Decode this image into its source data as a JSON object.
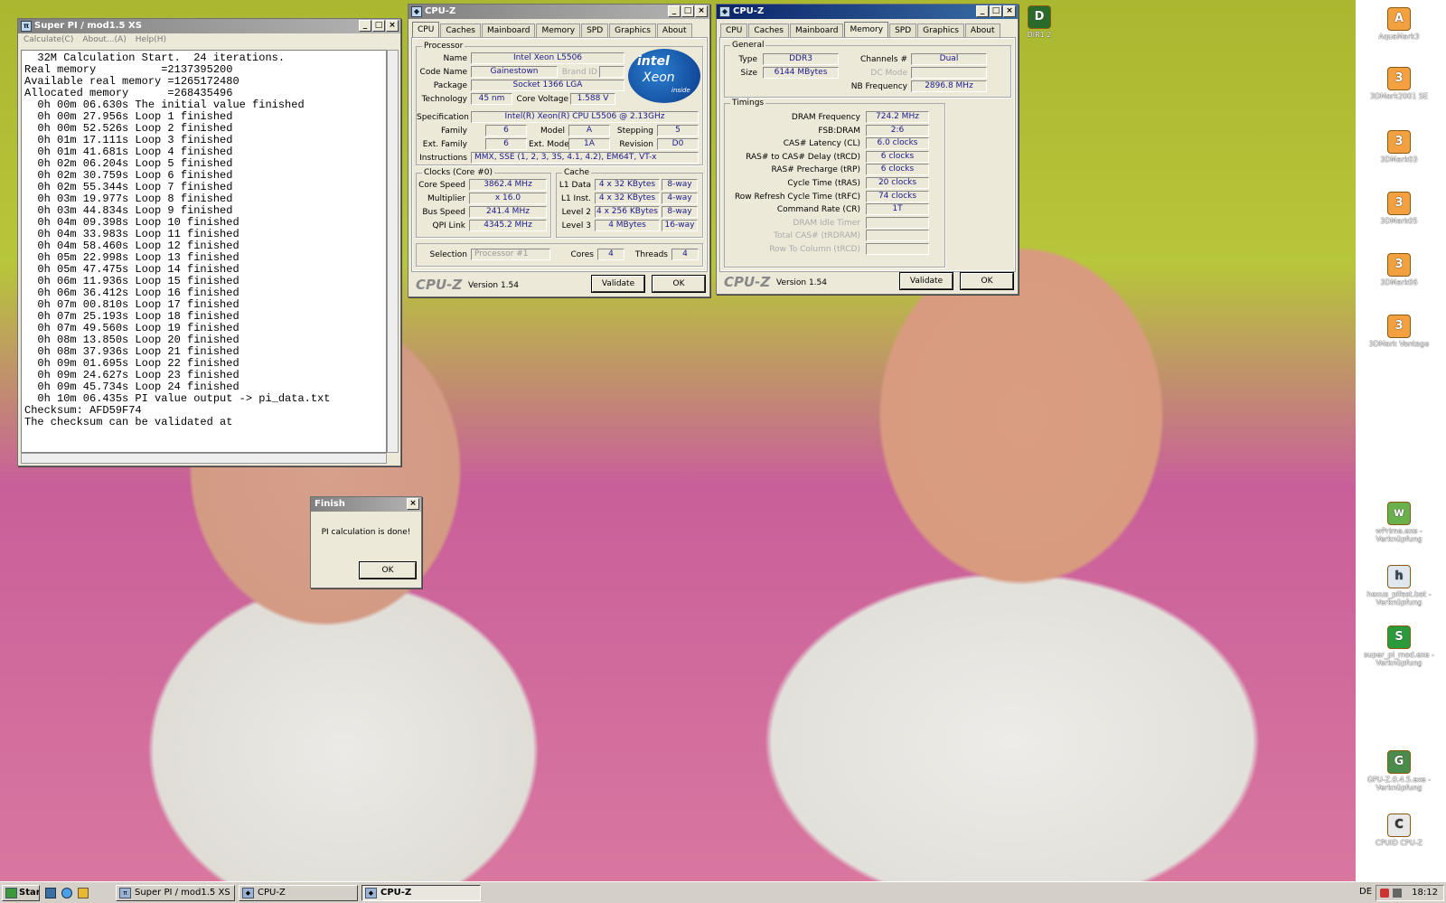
{
  "desktop": {
    "icons": [
      {
        "label": "AquaMark3",
        "glyph": "A"
      },
      {
        "label": "3DMark2001 SE",
        "glyph": "3"
      },
      {
        "label": "3DMark03",
        "glyph": "3"
      },
      {
        "label": "3DMark05",
        "glyph": "3"
      },
      {
        "label": "3DMark06",
        "glyph": "3"
      },
      {
        "label": "3DMark Vantage",
        "glyph": "3"
      },
      {
        "label": "wPrime.exe - Verknüpfung",
        "glyph": "w"
      },
      {
        "label": "hexus_pifast.bat - Verknüpfung",
        "glyph": "h"
      },
      {
        "label": "super_pi_mod.exe - Verknüpfung",
        "glyph": "S"
      },
      {
        "label": "GPU-Z.0.4.5.exe - Verknüpfung",
        "glyph": "G"
      },
      {
        "label": "CPUID CPU-Z",
        "glyph": "C"
      },
      {
        "label": "DIR1 2",
        "glyph": "D"
      }
    ]
  },
  "superpi": {
    "title": "Super PI / mod1.5 XS",
    "menu": [
      "Calculate(C)",
      "About...(A)",
      "Help(H)"
    ],
    "lines": [
      "  32M Calculation Start.  24 iterations.",
      "Real memory          =2137395200",
      "Available real memory =1265172480",
      "Allocated memory      =268435496",
      "  0h 00m 06.630s The initial value finished",
      "  0h 00m 27.956s Loop 1 finished",
      "  0h 00m 52.526s Loop 2 finished",
      "  0h 01m 17.111s Loop 3 finished",
      "  0h 01m 41.681s Loop 4 finished",
      "  0h 02m 06.204s Loop 5 finished",
      "  0h 02m 30.759s Loop 6 finished",
      "  0h 02m 55.344s Loop 7 finished",
      "  0h 03m 19.977s Loop 8 finished",
      "  0h 03m 44.834s Loop 9 finished",
      "  0h 04m 09.398s Loop 10 finished",
      "  0h 04m 33.983s Loop 11 finished",
      "  0h 04m 58.460s Loop 12 finished",
      "  0h 05m 22.998s Loop 13 finished",
      "  0h 05m 47.475s Loop 14 finished",
      "  0h 06m 11.936s Loop 15 finished",
      "  0h 06m 36.412s Loop 16 finished",
      "  0h 07m 00.810s Loop 17 finished",
      "  0h 07m 25.193s Loop 18 finished",
      "  0h 07m 49.560s Loop 19 finished",
      "  0h 08m 13.850s Loop 20 finished",
      "  0h 08m 37.936s Loop 21 finished",
      "  0h 09m 01.695s Loop 22 finished",
      "  0h 09m 24.627s Loop 23 finished",
      "  0h 09m 45.734s Loop 24 finished",
      "  0h 10m 06.435s PI value output -> pi_data.txt",
      "",
      "Checksum: AFD59F74",
      "The checksum can be validated at"
    ]
  },
  "finish": {
    "title": "Finish",
    "message": "PI calculation is done!",
    "ok": "OK"
  },
  "cpuz_common": {
    "title": "CPU-Z",
    "tabs": [
      "CPU",
      "Caches",
      "Mainboard",
      "Memory",
      "SPD",
      "Graphics",
      "About"
    ],
    "logo": "CPU-Z",
    "version": "Version 1.54",
    "validate": "Validate",
    "ok": "OK"
  },
  "cpu": {
    "processor_legend": "Processor",
    "name_label": "Name",
    "name": "Intel Xeon L5506",
    "codename_label": "Code Name",
    "codename": "Gainestown",
    "brandid_label": "Brand ID",
    "package_label": "Package",
    "package": "Socket 1366 LGA",
    "technology_label": "Technology",
    "technology": "45 nm",
    "corevoltage_label": "Core Voltage",
    "corevoltage": "1.588 V",
    "spec_label": "Specification",
    "spec": "Intel(R) Xeon(R) CPU          L5506  @ 2.13GHz",
    "family_label": "Family",
    "family": "6",
    "model_label": "Model",
    "model": "A",
    "stepping_label": "Stepping",
    "stepping": "5",
    "extfamily_label": "Ext. Family",
    "extfamily": "6",
    "extmodel_label": "Ext. Model",
    "extmodel": "1A",
    "revision_label": "Revision",
    "revision": "D0",
    "instr_label": "Instructions",
    "instr": "MMX, SSE (1, 2, 3, 3S, 4.1, 4.2), EM64T, VT-x",
    "clocks_legend": "Clocks (Core #0)",
    "corespeed_label": "Core Speed",
    "corespeed": "3862.4 MHz",
    "multiplier_label": "Multiplier",
    "multiplier": "x 16.0",
    "busspeed_label": "Bus Speed",
    "busspeed": "241.4 MHz",
    "qpi_label": "QPI Link",
    "qpi": "4345.2 MHz",
    "cache_legend": "Cache",
    "l1d_label": "L1 Data",
    "l1d": "4 x 32 KBytes",
    "l1d_way": "8-way",
    "l1i_label": "L1 Inst.",
    "l1i": "4 x 32 KBytes",
    "l1i_way": "4-way",
    "l2_label": "Level 2",
    "l2": "4 x 256 KBytes",
    "l2_way": "8-way",
    "l3_label": "Level 3",
    "l3": "4 MBytes",
    "l3_way": "16-way",
    "selection_label": "Selection",
    "selection": "Processor #1",
    "cores_label": "Cores",
    "cores": "4",
    "threads_label": "Threads",
    "threads": "4",
    "intel_logo": "intel",
    "xeon_logo": "Xeon",
    "inside_logo": "inside"
  },
  "mem": {
    "general_legend": "General",
    "type_label": "Type",
    "type": "DDR3",
    "size_label": "Size",
    "size": "6144 MBytes",
    "channels_label": "Channels #",
    "channels": "Dual",
    "dcmode_label": "DC Mode",
    "nbfreq_label": "NB Frequency",
    "nbfreq": "2896.8 MHz",
    "timings_legend": "Timings",
    "rows": [
      {
        "label": "DRAM Frequency",
        "value": "724.2 MHz"
      },
      {
        "label": "FSB:DRAM",
        "value": "2:6"
      },
      {
        "label": "CAS# Latency (CL)",
        "value": "6.0 clocks"
      },
      {
        "label": "RAS# to CAS# Delay (tRCD)",
        "value": "6 clocks"
      },
      {
        "label": "RAS# Precharge (tRP)",
        "value": "6 clocks"
      },
      {
        "label": "Cycle Time (tRAS)",
        "value": "20 clocks"
      },
      {
        "label": "Row Refresh Cycle Time (tRFC)",
        "value": "74 clocks"
      },
      {
        "label": "Command Rate (CR)",
        "value": "1T"
      },
      {
        "label": "DRAM Idle Timer",
        "value": ""
      },
      {
        "label": "Total CAS# (tRDRAM)",
        "value": ""
      },
      {
        "label": "Row To Column (tRCD)",
        "value": ""
      }
    ]
  },
  "taskbar": {
    "start": "Start",
    "items": [
      "Super PI / mod1.5 XS",
      "CPU-Z",
      "CPU-Z"
    ],
    "lang": "DE",
    "clock": "18:12"
  }
}
